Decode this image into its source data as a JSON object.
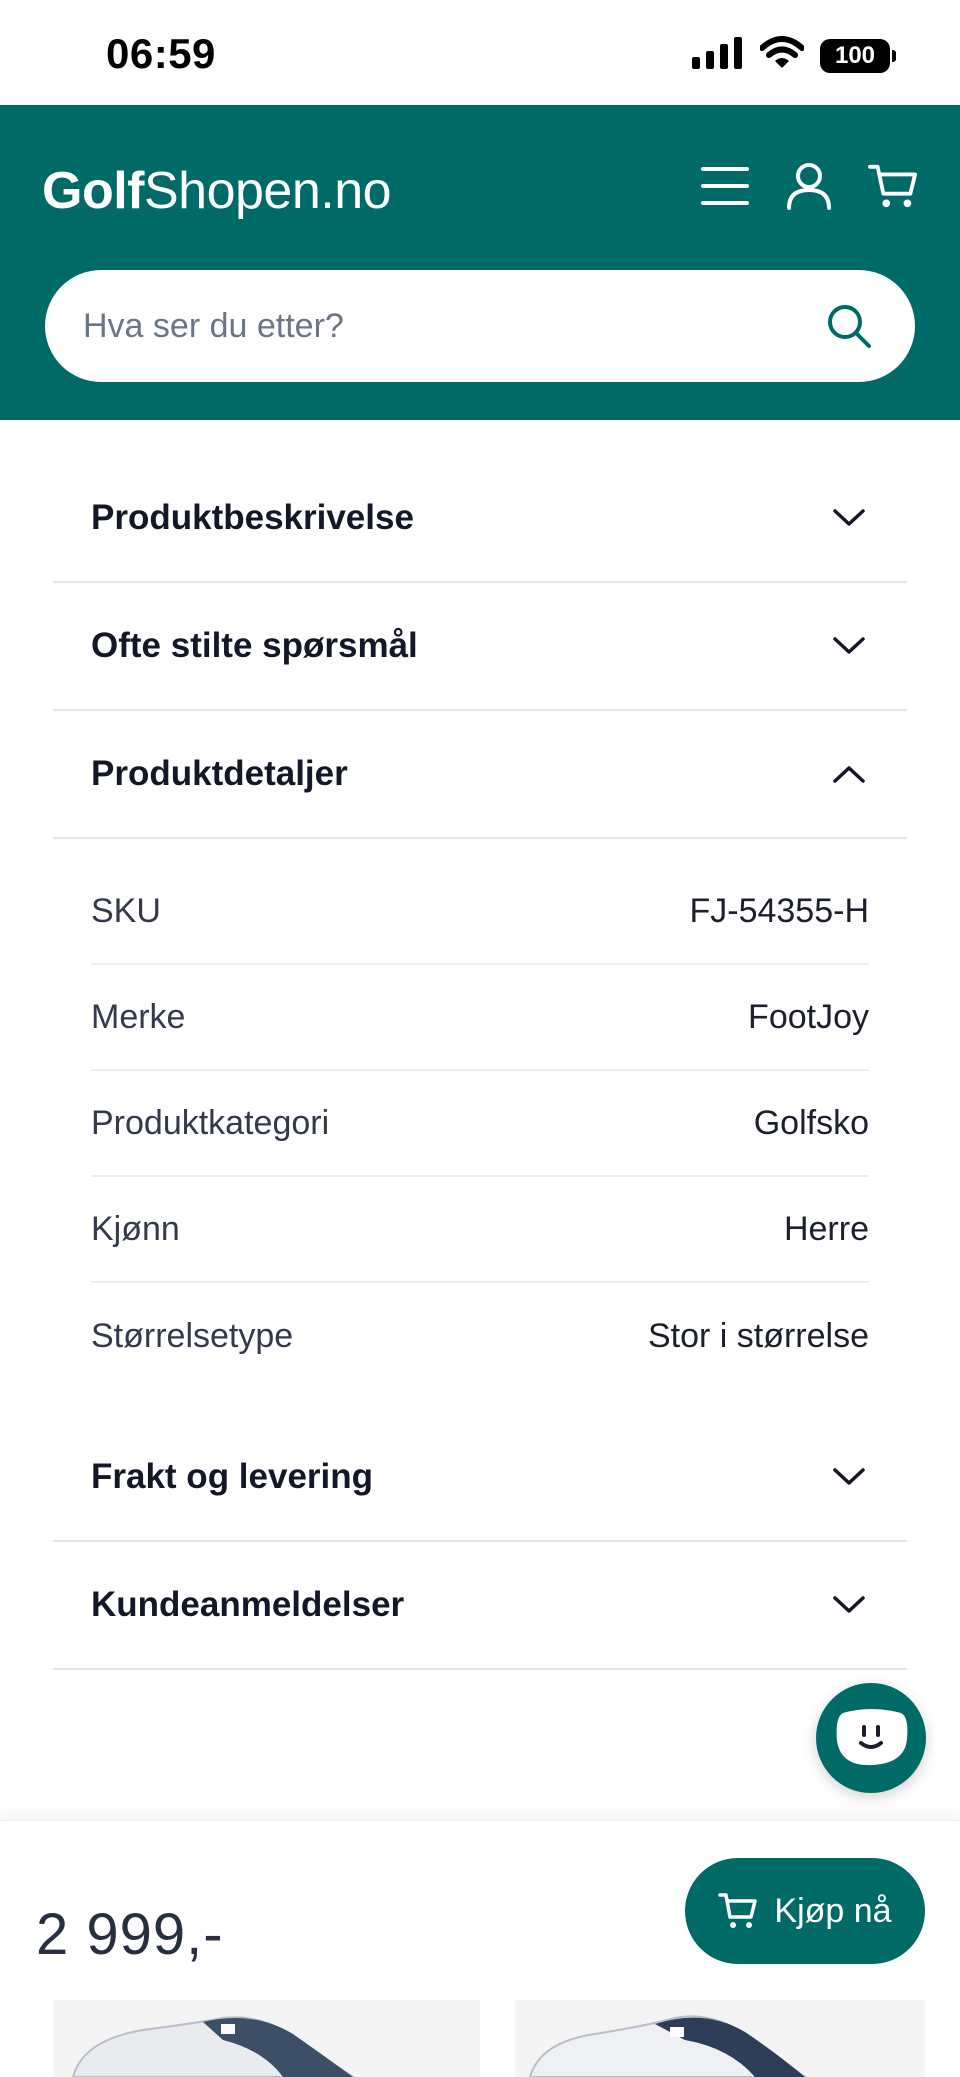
{
  "status_bar": {
    "time": "06:59",
    "battery": "100"
  },
  "header": {
    "logo_bold": "Golf",
    "logo_light": "Shopen.no",
    "brand_color": "#006b66",
    "icons": [
      "menu-icon",
      "user-icon",
      "cart-icon"
    ]
  },
  "search": {
    "placeholder": "Hva ser du etter?"
  },
  "accordion": {
    "description": "Produktbeskrivelse",
    "faq": "Ofte stilte spørsmål",
    "details": "Produktdetaljer",
    "shipping": "Frakt og levering",
    "reviews": "Kundeanmeldelser"
  },
  "details": {
    "rows": [
      {
        "label": "SKU",
        "value": "FJ-54355-H"
      },
      {
        "label": "Merke",
        "value": "FootJoy"
      },
      {
        "label": "Produktkategori",
        "value": "Golfsko"
      },
      {
        "label": "Kjønn",
        "value": "Herre"
      },
      {
        "label": "Størrelsetype",
        "value": "Stor i størrelse"
      }
    ]
  },
  "buy_bar": {
    "price": "2 999,-",
    "buy_label": "Kjøp nå"
  }
}
